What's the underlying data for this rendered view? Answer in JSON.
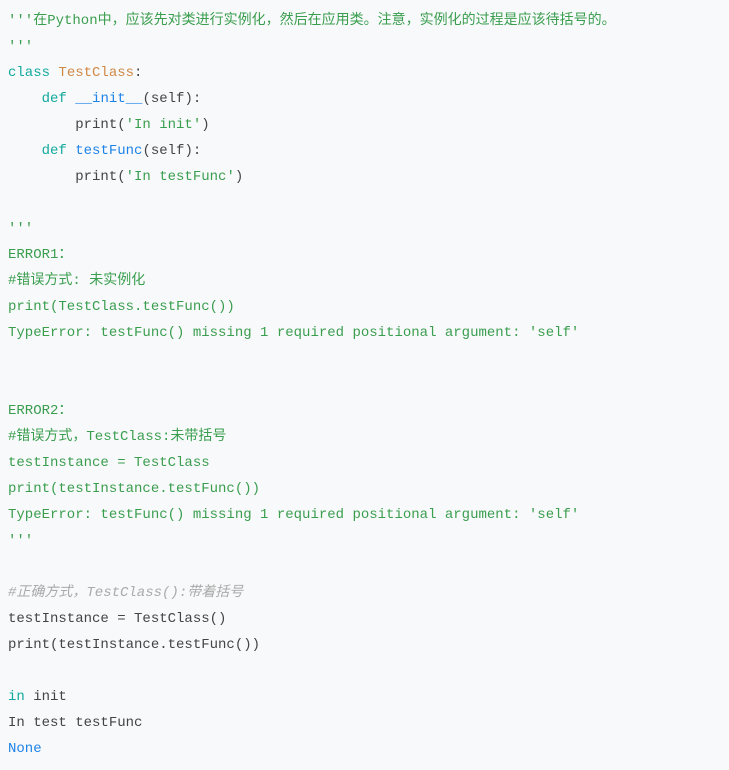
{
  "lines": {
    "l1_a": "'''在Python中，应该先对类进行实例化，然后在应用类。注意，实例化的过程是应该待括号的。",
    "l2_a": "'''",
    "l3_a": "class",
    "l3_b": " ",
    "l3_c": "TestClass",
    "l3_d": ":",
    "l4_a": "    ",
    "l4_b": "def",
    "l4_c": " ",
    "l4_d": "__init__",
    "l4_e": "(self):",
    "l5_a": "        print(",
    "l5_b": "'In init'",
    "l5_c": ")",
    "l6_a": "    ",
    "l6_b": "def",
    "l6_c": " ",
    "l6_d": "testFunc",
    "l6_e": "(self):",
    "l7_a": "        print(",
    "l7_b": "'In testFunc'",
    "l7_c": ")",
    "l9_a": "'''",
    "l10_a": "ERROR1：",
    "l11_a": "#错误方式: 未实例化",
    "l12_a": "print(TestClass.testFunc())",
    "l13_a": "TypeError: testFunc() missing 1 required positional argument: 'self'",
    "l15_a": "ERROR2：",
    "l16_a": "#错误方式，TestClass:未带括号",
    "l17_a": "testInstance = TestClass",
    "l18_a": "print(testInstance.testFunc())",
    "l19_a": "TypeError: testFunc() missing 1 required positional argument: 'self'",
    "l20_a": "'''",
    "l22_a": "#正确方式，TestClass():带着括号",
    "l23_a": "testInstance = TestClass()",
    "l24_a": "print(testInstance.testFunc())",
    "l26_a": "in",
    "l26_b": " init",
    "l27_a": "In test testFunc",
    "l28_a": "None"
  }
}
